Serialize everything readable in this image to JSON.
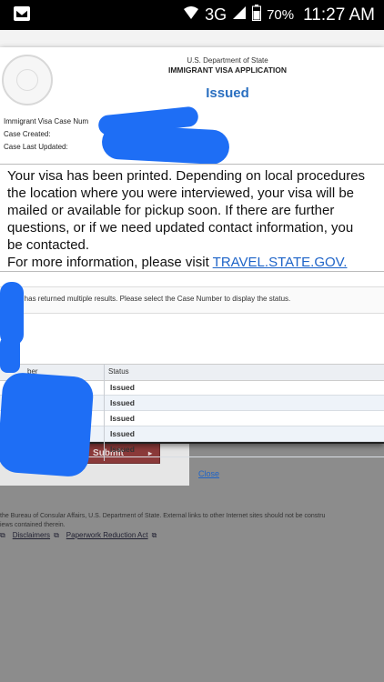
{
  "status_bar": {
    "network": "3G",
    "battery": "70%",
    "time": "11:27 AM"
  },
  "modal": {
    "department": "U.S. Department of State",
    "app_title": "IMMIGRANT VISA APPLICATION",
    "status_title": "Issued",
    "fields": {
      "case_number_label": "Immigrant Visa Case Num",
      "case_created_label": "Case Created:",
      "case_updated_label": "Case Last Updated:"
    },
    "message_lines": [
      "Your visa has been printed. Depending on local procedures",
      "the location where you were interviewed, your visa will be",
      "mailed or available for pickup soon. If there are further",
      "questions, or if we need updated contact information, you",
      "be contacted."
    ],
    "more_info_prefix": "For more information, please visit ",
    "more_info_link": "TRAVEL.STATE.GOV.",
    "search_notice": "ch has returned multiple results. Please select the Case Number to display the status.",
    "table": {
      "header_case": "ber",
      "header_status": "Status",
      "rows": [
        "Issued",
        "Issued",
        "Issued",
        "Issued",
        "Issued"
      ]
    },
    "close_label": "Close"
  },
  "page": {
    "submit_label": "Submit",
    "footer_line1": "the Bureau of Consular Affairs, U.S. Department of State. External links to other Internet sites should not be constru",
    "footer_line2": "iews contained therein.",
    "link_disclaimers": "Disclaimers",
    "link_paperwork": "Paperwork Reduction Act"
  },
  "colors": {
    "accent_blue": "#2a6fc0",
    "link_blue": "#1e64c8",
    "redaction_blue": "#1e6ef5",
    "submit_red": "#8b3a3a"
  }
}
